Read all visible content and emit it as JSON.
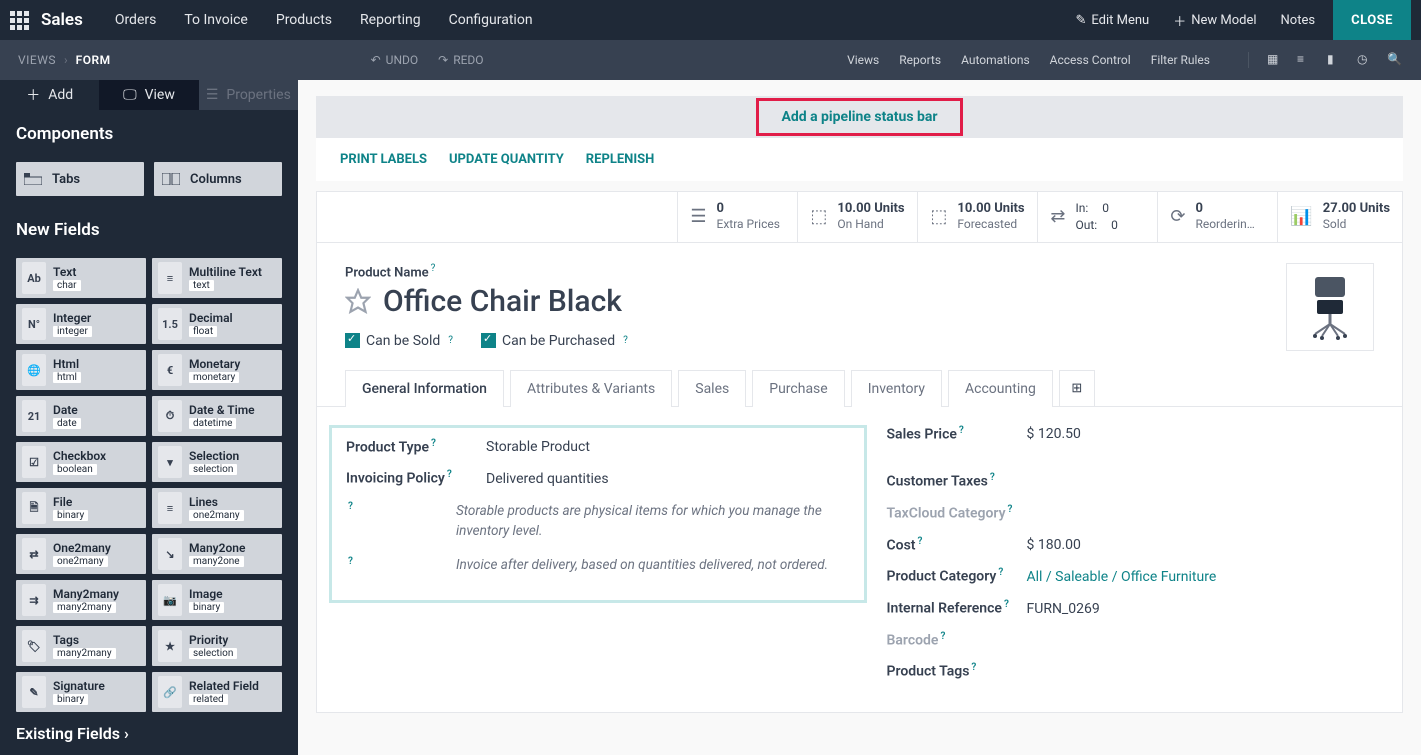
{
  "top_nav": {
    "brand": "Sales",
    "menu": [
      "Orders",
      "To Invoice",
      "Products",
      "Reporting",
      "Configuration"
    ],
    "edit_menu": "Edit Menu",
    "new_model": "New Model",
    "notes": "Notes",
    "close": "CLOSE"
  },
  "sub_nav": {
    "crumb1": "VIEWS",
    "crumb2": "FORM",
    "undo": "UNDO",
    "redo": "REDO",
    "right": [
      "Views",
      "Reports",
      "Automations",
      "Access Control",
      "Filter Rules"
    ]
  },
  "sidebar": {
    "tabs": {
      "add": "Add",
      "view": "View",
      "props": "Properties"
    },
    "components_title": "Components",
    "comp_tabs": "Tabs",
    "comp_columns": "Columns",
    "new_fields_title": "New Fields",
    "fields": [
      {
        "icon": "Ab",
        "label": "Text",
        "type": "char"
      },
      {
        "icon": "≡",
        "label": "Multiline Text",
        "type": "text"
      },
      {
        "icon": "N°",
        "label": "Integer",
        "type": "integer"
      },
      {
        "icon": "1.5",
        "label": "Decimal",
        "type": "float"
      },
      {
        "icon": "🌐",
        "label": "Html",
        "type": "html"
      },
      {
        "icon": "€",
        "label": "Monetary",
        "type": "monetary"
      },
      {
        "icon": "21",
        "label": "Date",
        "type": "date"
      },
      {
        "icon": "⏱",
        "label": "Date & Time",
        "type": "datetime"
      },
      {
        "icon": "☑",
        "label": "Checkbox",
        "type": "boolean"
      },
      {
        "icon": "▾",
        "label": "Selection",
        "type": "selection"
      },
      {
        "icon": "🗎",
        "label": "File",
        "type": "binary"
      },
      {
        "icon": "≡",
        "label": "Lines",
        "type": "one2many"
      },
      {
        "icon": "⇄",
        "label": "One2many",
        "type": "one2many"
      },
      {
        "icon": "↘",
        "label": "Many2one",
        "type": "many2one"
      },
      {
        "icon": "⇉",
        "label": "Many2many",
        "type": "many2many"
      },
      {
        "icon": "📷",
        "label": "Image",
        "type": "binary"
      },
      {
        "icon": "🏷",
        "label": "Tags",
        "type": "many2many"
      },
      {
        "icon": "★",
        "label": "Priority",
        "type": "selection"
      },
      {
        "icon": "✎",
        "label": "Signature",
        "type": "binary"
      },
      {
        "icon": "🔗",
        "label": "Related Field",
        "type": "related"
      }
    ],
    "existing": "Existing Fields"
  },
  "banner": {
    "link": "Add a pipeline status bar"
  },
  "actions": [
    "PRINT LABELS",
    "UPDATE QUANTITY",
    "REPLENISH"
  ],
  "stats": [
    {
      "num": "0",
      "lbl": "Extra Prices"
    },
    {
      "num": "10.00 Units",
      "lbl": "On Hand"
    },
    {
      "num": "10.00 Units",
      "lbl": "Forecasted"
    },
    {
      "in_l": "In:",
      "in_v": "0",
      "out_l": "Out:",
      "out_v": "0"
    },
    {
      "num": "0",
      "lbl": "Reorderin…"
    },
    {
      "num": "27.00 Units",
      "lbl": "Sold"
    }
  ],
  "product": {
    "name_label": "Product Name",
    "name": "Office Chair Black",
    "can_sold": "Can be Sold",
    "can_purchased": "Can be Purchased"
  },
  "tabs": [
    "General Information",
    "Attributes & Variants",
    "Sales",
    "Purchase",
    "Inventory",
    "Accounting"
  ],
  "form": {
    "left": [
      {
        "label": "Product Type",
        "val": "Storable Product"
      },
      {
        "label": "Invoicing Policy",
        "val": "Delivered quantities"
      },
      {
        "label": "",
        "val": "Storable products are physical items for which you manage the inventory level.",
        "italic": true
      },
      {
        "label": "",
        "val": "Invoice after delivery, based on quantities delivered, not ordered.",
        "italic": true
      }
    ],
    "right": [
      {
        "label": "Sales Price",
        "val": "$ 120.50"
      },
      {
        "label": "Customer Taxes",
        "val": "",
        "muted": false
      },
      {
        "label": "TaxCloud Category",
        "val": "",
        "muted": true
      },
      {
        "label": "Cost",
        "val": "$ 180.00"
      },
      {
        "label": "Product Category",
        "val": "All / Saleable / Office Furniture",
        "link": true
      },
      {
        "label": "Internal Reference",
        "val": "FURN_0269"
      },
      {
        "label": "Barcode",
        "val": "",
        "muted": true
      },
      {
        "label": "Product Tags",
        "val": ""
      }
    ]
  }
}
